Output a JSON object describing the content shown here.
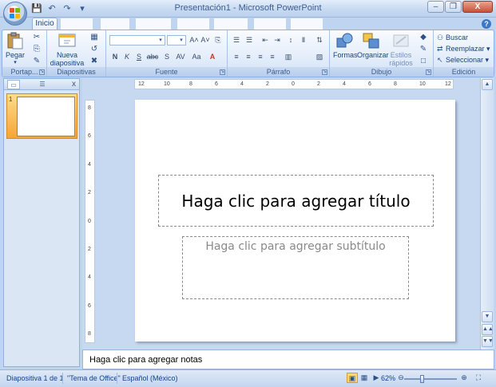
{
  "window": {
    "title": "Presentación1 - Microsoft PowerPoint",
    "controls": [
      "–",
      "❐",
      "X"
    ]
  },
  "quick_access": [
    "save-icon",
    "undo-icon",
    "redo-icon",
    "customize-icon"
  ],
  "tabs": [
    {
      "label": "Inicio",
      "active": true
    }
  ],
  "ribbon": {
    "groups": {
      "portapapeles": {
        "label": "Portap...",
        "paste_label": "Pegar"
      },
      "diapositivas": {
        "label": "Diapositivas",
        "new_slide_label": "Nueva diapositiva"
      },
      "fuente": {
        "label": "Fuente",
        "format_buttons": [
          "N",
          "K",
          "S",
          "abc",
          "S",
          "AV",
          "Aa"
        ]
      },
      "parrafo": {
        "label": "Párrafo"
      },
      "dibujo": {
        "label": "Dibujo",
        "shapes_label": "Formas",
        "arrange_label": "Organizar",
        "styles_label": "Estilos rápidos"
      },
      "edicion": {
        "label": "Edición",
        "find_label": "Buscar",
        "replace_label": "Reemplazar",
        "select_label": "Seleccionar"
      }
    }
  },
  "slides_panel": {
    "close_label": "x",
    "slides": [
      {
        "number": "1"
      }
    ]
  },
  "ruler": {
    "horizontal_ticks": [
      "12",
      "10",
      "8",
      "6",
      "4",
      "2",
      "0",
      "2",
      "4",
      "6",
      "8",
      "10",
      "12"
    ],
    "vertical_ticks": [
      "8",
      "6",
      "4",
      "2",
      "0",
      "2",
      "4",
      "6",
      "8"
    ]
  },
  "slide": {
    "title_placeholder": "Haga clic para agregar título",
    "subtitle_placeholder": "Haga clic para agregar subtítulo"
  },
  "notes": {
    "placeholder": "Haga clic para agregar notas"
  },
  "statusbar": {
    "slide_indicator": "Diapositiva 1 de 1",
    "theme": "\"Tema de Office\"",
    "language": "Español (México)",
    "zoom": "62%",
    "zoom_fraction": 0.31
  },
  "colors": {
    "accent": "#15428b",
    "ribbon_bg": "#dbe6f5",
    "thumb_selected": "#f7a536"
  }
}
